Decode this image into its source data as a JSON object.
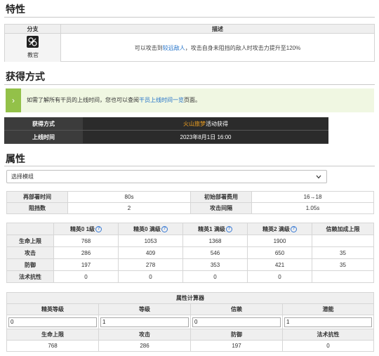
{
  "trait": {
    "title": "特性",
    "col_branch": "分支",
    "col_desc": "描述",
    "branch_name": "教官",
    "desc_before": "可以攻击到",
    "desc_highlight": "较远敌人",
    "desc_after": "，攻击自身未阻挡的敌人时攻击力提升至120%"
  },
  "acquisition": {
    "title": "获得方式",
    "note_before": "如需了解所有干员的上线时间，您也可以查阅",
    "note_link": "干员上线时间一览",
    "note_after": "页面。",
    "method_label": "获得方式",
    "method_highlight": "火山旅梦",
    "method_rest": "活动获得",
    "release_label": "上线时间",
    "release_value": "2023年8月1日 16:00"
  },
  "attributes": {
    "title": "属性",
    "select_value": "选择模组",
    "redeploy_label": "再部署时间",
    "redeploy_value": "80s",
    "cost_label": "初始部署费用",
    "cost_value": "16→18",
    "block_label": "阻挡数",
    "block_value": "2",
    "interval_label": "攻击间隔",
    "interval_value": "1.05s"
  },
  "stats": {
    "headers": [
      "精英0 1级",
      "精英0 满级",
      "精英1 满级",
      "精英2 满级",
      "信赖加成上限"
    ],
    "rows": [
      {
        "label": "生命上限",
        "values": [
          "768",
          "1053",
          "1368",
          "1900",
          ""
        ]
      },
      {
        "label": "攻击",
        "values": [
          "286",
          "409",
          "546",
          "650",
          "35"
        ]
      },
      {
        "label": "防御",
        "values": [
          "197",
          "278",
          "353",
          "421",
          "35"
        ]
      },
      {
        "label": "法术抗性",
        "values": [
          "0",
          "0",
          "0",
          "0",
          ""
        ]
      }
    ]
  },
  "calculator": {
    "title": "属性计算器",
    "input_labels": [
      "精英等级",
      "等级",
      "信赖",
      "潜能"
    ],
    "input_values": [
      "0",
      "1",
      "0",
      "1"
    ],
    "result_labels": [
      "生命上限",
      "攻击",
      "防御",
      "法术抗性"
    ],
    "result_values": [
      "768",
      "286",
      "197",
      "0"
    ]
  },
  "colors": {
    "accent_blue": "#1e6fc8",
    "note_green": "#93c149",
    "event_orange": "#f0a020",
    "dark_header": "#3c3c3c"
  }
}
